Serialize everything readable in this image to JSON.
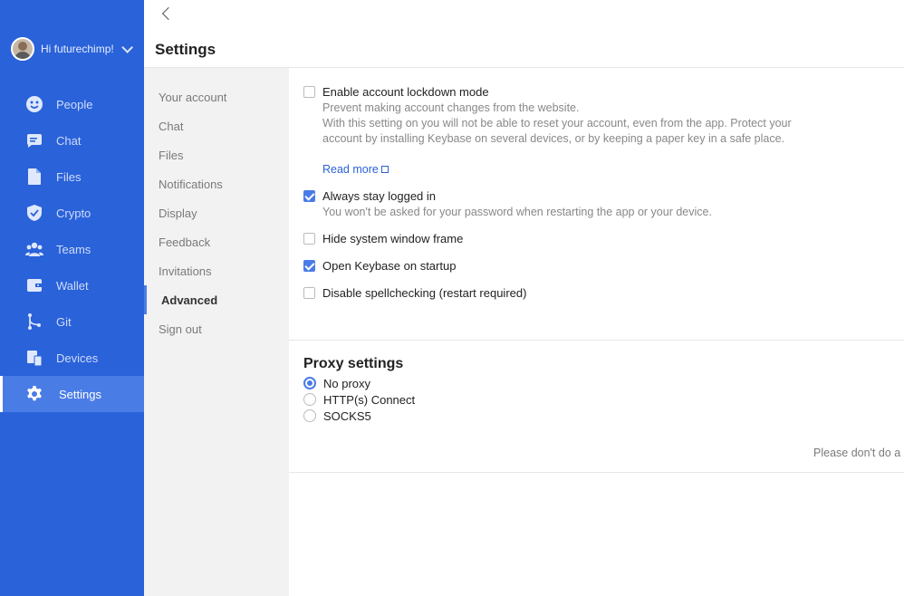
{
  "user": {
    "greeting": "Hi futurechimp!"
  },
  "nav": {
    "items": [
      {
        "label": "People",
        "icon": "people-icon"
      },
      {
        "label": "Chat",
        "icon": "chat-icon"
      },
      {
        "label": "Files",
        "icon": "files-icon"
      },
      {
        "label": "Crypto",
        "icon": "crypto-icon"
      },
      {
        "label": "Teams",
        "icon": "teams-icon"
      },
      {
        "label": "Wallet",
        "icon": "wallet-icon"
      },
      {
        "label": "Git",
        "icon": "git-icon"
      },
      {
        "label": "Devices",
        "icon": "devices-icon"
      },
      {
        "label": "Settings",
        "icon": "gear-icon",
        "active": true
      }
    ]
  },
  "header": {
    "title": "Settings"
  },
  "submenu": {
    "items": [
      "Your account",
      "Chat",
      "Files",
      "Notifications",
      "Display",
      "Feedback",
      "Invitations",
      "Advanced",
      "Sign out"
    ],
    "active": "Advanced"
  },
  "advanced": {
    "lockdown": {
      "label": "Enable account lockdown mode",
      "checked": false,
      "desc1": "Prevent making account changes from the website.",
      "desc2": "With this setting on you will not be able to reset your account, even from the app. Protect your account by installing Keybase on several devices, or by keeping a paper key in a safe place.",
      "read_more": "Read more"
    },
    "stay_logged_in": {
      "label": "Always stay logged in",
      "checked": true,
      "desc": "You won't be asked for your password when restarting the app or your device."
    },
    "hide_frame": {
      "label": "Hide system window frame",
      "checked": false
    },
    "open_on_startup": {
      "label": "Open Keybase on startup",
      "checked": true
    },
    "disable_spellcheck": {
      "label": "Disable spellchecking (restart required)",
      "checked": false
    }
  },
  "proxy": {
    "title": "Proxy settings",
    "options": [
      "No proxy",
      "HTTP(s) Connect",
      "SOCKS5"
    ],
    "selected": "No proxy",
    "warning": "Please don't do a"
  },
  "colors": {
    "nav_bg": "#2a62d9",
    "nav_active": "#4a7ce6",
    "accent": "#4a7ce6",
    "link": "#2a62d9"
  }
}
